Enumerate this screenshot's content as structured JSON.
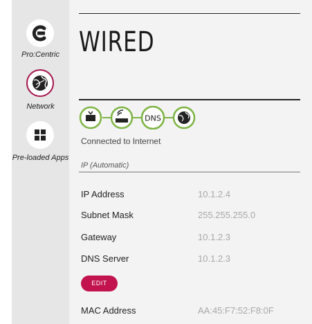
{
  "sidebar": {
    "items": [
      {
        "label": "Pro:Centric",
        "icon": "pro-centric-icon",
        "active": false
      },
      {
        "label": "Network",
        "icon": "globe-network-icon",
        "active": true
      },
      {
        "label": "Pre-loaded Apps",
        "icon": "grid-apps-icon",
        "active": false
      }
    ]
  },
  "main": {
    "title": "WIRED",
    "connection_chain": [
      "tv-icon",
      "router-icon",
      "DNS",
      "globe-icon"
    ],
    "status_text": "Connected to Internet",
    "ip_mode": "IP (Automatic)",
    "details": [
      {
        "label": "IP Address",
        "value": "10.1.2.4"
      },
      {
        "label": "Subnet Mask",
        "value": "255.255.255.0"
      },
      {
        "label": "Gateway",
        "value": "10.1.2.3"
      },
      {
        "label": "DNS Server",
        "value": "10.1.2.3"
      }
    ],
    "edit_label": "EDIT",
    "mac": {
      "label": "MAC Address",
      "value": "AA:45:F7:52:F8:0F"
    }
  },
  "colors": {
    "accent": "#c2134f",
    "chain_green": "#7cb342",
    "sidebar_bg": "#e6e6e6",
    "panel_bg": "#f3f3f3",
    "value_gray": "#a8a8a8"
  }
}
